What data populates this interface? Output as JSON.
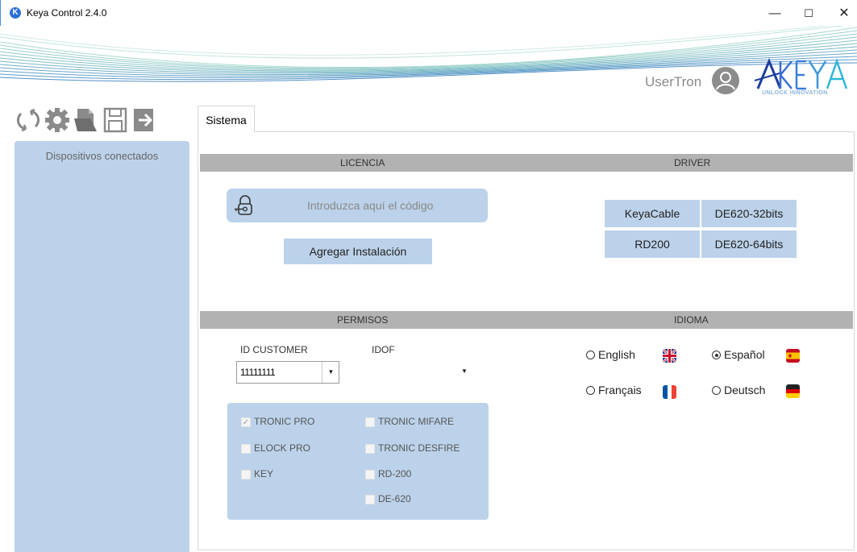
{
  "window": {
    "title": "Keya Control 2.4.0",
    "minimize": "—",
    "maximize": "☐",
    "close": "✕"
  },
  "header": {
    "username": "UserTron",
    "logo_text": "KEYA",
    "logo_tagline": "UNLOCK INNOVATION"
  },
  "toolbar": {
    "icons": [
      "refresh-icon",
      "settings-icon",
      "open-file-icon",
      "save-icon",
      "exit-icon"
    ]
  },
  "sidebar": {
    "title": "Dispositivos conectados"
  },
  "tabs": [
    {
      "label": "Sistema",
      "active": true
    }
  ],
  "license": {
    "section_title": "LICENCIA",
    "code_placeholder": "Introduzca aquí el código",
    "add_button": "Agregar Instalación"
  },
  "driver": {
    "section_title": "DRIVER",
    "buttons": [
      "KeyaCable",
      "DE620-32bits",
      "RD200",
      "DE620-64bits"
    ]
  },
  "permissions": {
    "section_title": "PERMISOS",
    "id_customer_label": "ID CUSTOMER",
    "id_customer_value": "11111111",
    "idof_label": "IDOF",
    "idof_value": "",
    "checkboxes": [
      {
        "label": "TRONIC PRO",
        "checked": true
      },
      {
        "label": "TRONIC MIFARE",
        "checked": false
      },
      {
        "label": "ELOCK PRO",
        "checked": false
      },
      {
        "label": "TRONIC DESFIRE",
        "checked": false
      },
      {
        "label": "KEY",
        "checked": false
      },
      {
        "label": "RD-200",
        "checked": false
      },
      {
        "label": "DE-620",
        "checked": false
      }
    ]
  },
  "language": {
    "section_title": "IDIOMA",
    "options": [
      {
        "label": "English",
        "selected": false,
        "flag": "uk-flag-icon"
      },
      {
        "label": "Español",
        "selected": true,
        "flag": "spain-flag-icon"
      },
      {
        "label": "Français",
        "selected": false,
        "flag": "france-flag-icon"
      },
      {
        "label": "Deutsch",
        "selected": false,
        "flag": "germany-flag-icon"
      }
    ]
  },
  "colors": {
    "panel_blue": "#bcd2ea",
    "section_gray": "#b2b2b2",
    "accent": "#2b6fd6"
  }
}
